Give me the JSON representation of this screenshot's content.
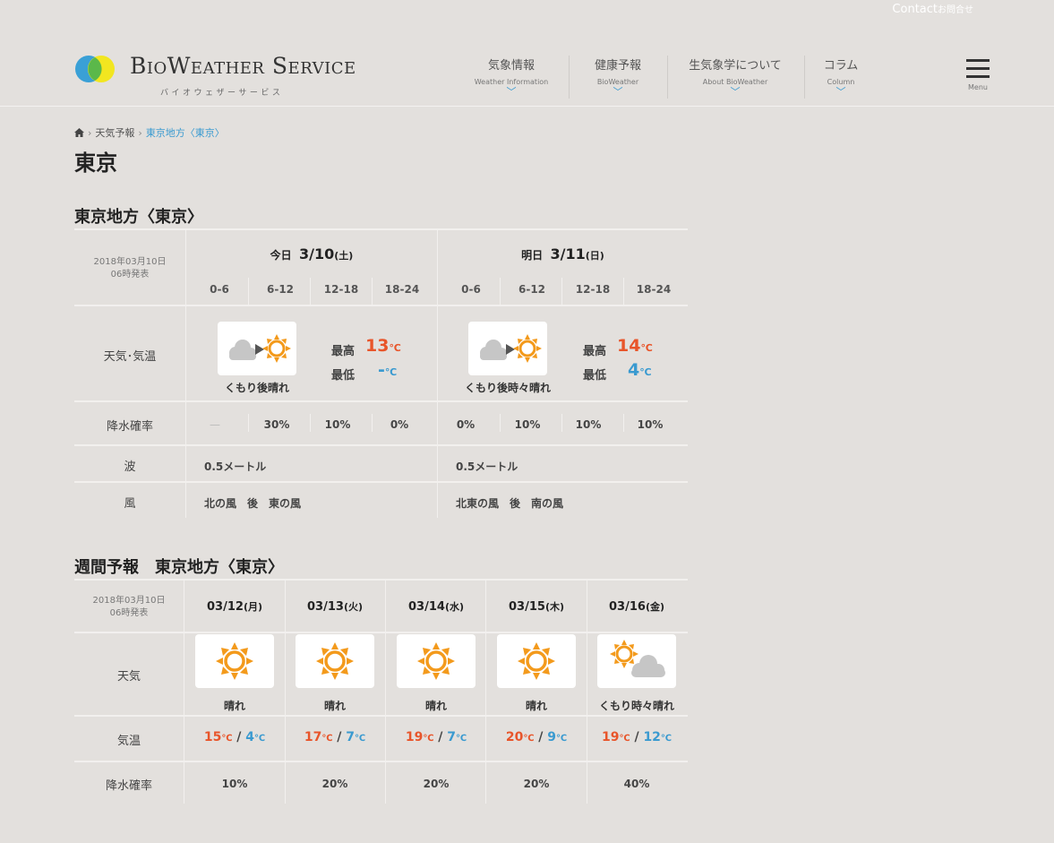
{
  "header": {
    "contact": "Contact",
    "contact_sub": "お問合せ",
    "logo_text": "BioWeather Service",
    "logo_sub": "バイオウェザーサービス",
    "nav": [
      {
        "jp": "気象情報",
        "en": "Weather Information"
      },
      {
        "jp": "健康予報",
        "en": "BioWeather"
      },
      {
        "jp": "生気象学について",
        "en": "About BioWeather"
      },
      {
        "jp": "コラム",
        "en": "Column"
      }
    ],
    "menu_label": "Menu",
    "chevron": "﹀"
  },
  "breadcrumb": {
    "level1": "天気予報",
    "current": "東京地方〈東京〉",
    "sep": "›"
  },
  "page_title": "東京",
  "forecast": {
    "section_title": "東京地方〈東京〉",
    "issued_date": "2018年03月10日",
    "issued_time": "06時発表",
    "row_labels": {
      "weather": "天気･気温",
      "rain": "降水確率",
      "wave": "波",
      "wind": "風"
    },
    "slots": [
      "0-6",
      "6-12",
      "12-18",
      "18-24"
    ],
    "high_label": "最高",
    "low_label": "最低",
    "unit": "℃",
    "days": [
      {
        "label": "今日",
        "date": "3/10",
        "weekday": "(土)",
        "weather": "くもり後晴れ",
        "icon": "cloud-then-sun-icon",
        "high": "13",
        "low": "-",
        "rain": [
          "—",
          "30%",
          "10%",
          "0%"
        ],
        "wave": "0.5メートル",
        "wind": "北の風　後　東の風"
      },
      {
        "label": "明日",
        "date": "3/11",
        "weekday": "(日)",
        "weather": "くもり後時々晴れ",
        "icon": "cloud-then-sun-icon",
        "high": "14",
        "low": "4",
        "rain": [
          "0%",
          "10%",
          "10%",
          "10%"
        ],
        "wave": "0.5メートル",
        "wind": "北東の風　後　南の風"
      }
    ]
  },
  "weekly": {
    "section_title": "週間予報　東京地方〈東京〉",
    "issued_date": "2018年03月10日",
    "issued_time": "06時発表",
    "row_labels": {
      "weather": "天気",
      "temp": "気温",
      "rain": "降水確率"
    },
    "unit": "℃",
    "slash": "/",
    "days": [
      {
        "date": "03/12",
        "weekday": "(月)",
        "weather": "晴れ",
        "icon": "sun-icon",
        "high": "15",
        "low": "4",
        "rain": "10%"
      },
      {
        "date": "03/13",
        "weekday": "(火)",
        "weather": "晴れ",
        "icon": "sun-icon",
        "high": "17",
        "low": "7",
        "rain": "20%"
      },
      {
        "date": "03/14",
        "weekday": "(水)",
        "weather": "晴れ",
        "icon": "sun-icon",
        "high": "19",
        "low": "7",
        "rain": "20%"
      },
      {
        "date": "03/15",
        "weekday": "(木)",
        "weather": "晴れ",
        "icon": "sun-icon",
        "high": "20",
        "low": "9",
        "rain": "20%"
      },
      {
        "date": "03/16",
        "weekday": "(金)",
        "weather": "くもり時々晴れ",
        "icon": "sun-and-cloud-icon",
        "high": "19",
        "low": "12",
        "rain": "40%"
      }
    ]
  },
  "colors": {
    "accent": "#3a9ad0",
    "high": "#e8552a",
    "low": "#3a9ad0",
    "sun": "#f39a1c",
    "background": "#e3e0dd"
  }
}
